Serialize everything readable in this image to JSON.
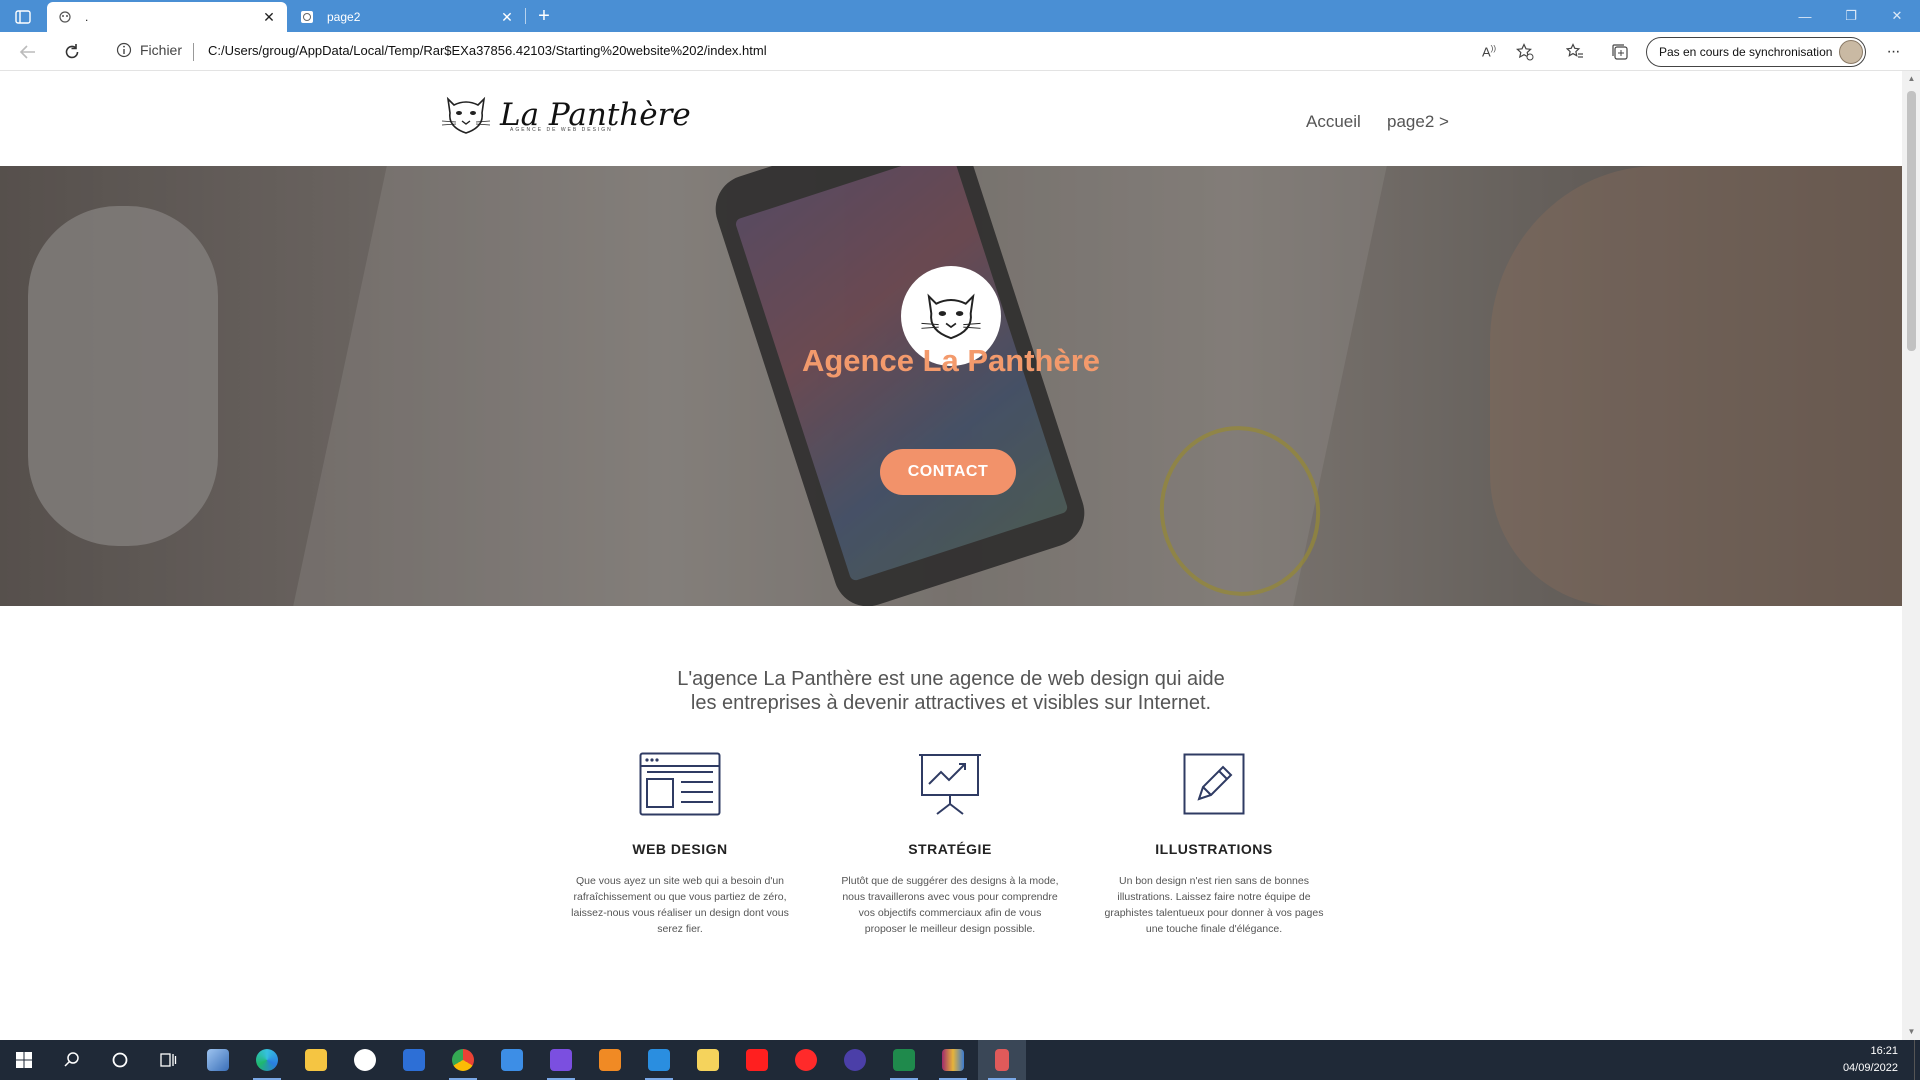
{
  "browser": {
    "tabs": [
      {
        "title": ".",
        "active": true
      },
      {
        "title": "page2",
        "active": false
      }
    ],
    "address": {
      "info_label": "Fichier",
      "url": "C:/Users/groug/AppData/Local/Temp/Rar$EXa37856.42103/Starting%20website%202/index.html"
    },
    "sync_label": "Pas en cours de synchronisation"
  },
  "site": {
    "logo_text": "La Panthère",
    "logo_tagline": "AGENCE DE WEB DESIGN",
    "nav": [
      {
        "label": "Accueil"
      },
      {
        "label": "page2 >"
      }
    ],
    "hero": {
      "title": "Agence La Panthère",
      "cta": "CONTACT"
    },
    "intro_line1": "L'agence La Panthère est une agence de web design qui aide",
    "intro_line2": "les entreprises à devenir attractives et visibles sur Internet.",
    "services": [
      {
        "icon": "web-design-icon",
        "title": "WEB DESIGN",
        "description": "Que vous ayez un site web qui a besoin d'un rafraîchissement ou que vous partiez de zéro, laissez-nous vous réaliser un design dont vous serez fier."
      },
      {
        "icon": "strategy-chart-icon",
        "title": "STRATÉGIE",
        "description": "Plutôt que de suggérer des designs à la mode, nous travaillerons avec vous pour comprendre vos objectifs commerciaux afin de vous proposer le meilleur design possible."
      },
      {
        "icon": "pencil-icon",
        "title": "ILLUSTRATIONS",
        "description": "Un bon design n'est rien sans de bonnes illustrations. Laissez faire notre équipe de graphistes talentueux pour donner à vos pages une touche finale d'élégance."
      }
    ]
  },
  "taskbar": {
    "time": "16:21",
    "date": "04/09/2022"
  },
  "colors": {
    "browser_accent": "#4a8fd4",
    "brand_orange": "#f2926a",
    "hero_title": "#f39a6c",
    "icon_navy": "#2f3b63",
    "taskbar": "#1f2937"
  }
}
